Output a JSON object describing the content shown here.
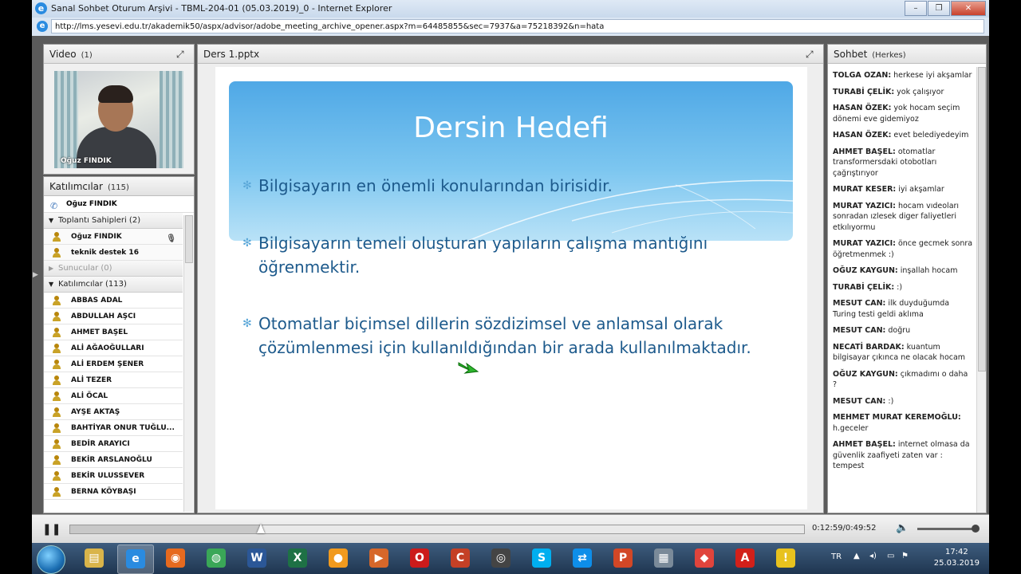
{
  "browser": {
    "title": "Sanal Sohbet Oturum Arşivi - TBML-204-01 (05.03.2019)_0 - Internet Explorer",
    "url": "http://lms.yesevi.edu.tr/akademik50/aspx/advisor/adobe_meeting_archive_opener.aspx?m=64485855&sec=7937&a=75218392&n=hata",
    "controls": [
      "–",
      "❐",
      "✕"
    ]
  },
  "video": {
    "title": "Video",
    "count": "(1)",
    "presenter": "Oğuz FINDIK"
  },
  "attendees": {
    "title": "Katılımcılar",
    "count": "(115)",
    "me": "Oğuz FINDIK",
    "hosts_group": "Toplantı Sahipleri (2)",
    "hosts": [
      "Oğuz FINDIK",
      "teknik destek 16"
    ],
    "presenters_group": "Sunucular (0)",
    "participants_group": "Katılımcılar (113)",
    "participants": [
      "ABBAS ADAL",
      "ABDULLAH AŞCI",
      "AHMET BAŞEL",
      "ALİ AĞAOĞULLARI",
      "ALİ ERDEM ŞENER",
      "ALİ TEZER",
      "ALİ ÖCAL",
      "AYŞE AKTAŞ",
      "BAHTİYAR ONUR TUĞLU...",
      "BEDİR ARAYICI",
      "BEKİR ARSLANOĞLU",
      "BEKİR ULUSSEVER",
      "BERNA KÖYBAŞI"
    ]
  },
  "share": {
    "title": "Ders 1.pptx",
    "slide_title": "Dersin Hedefi",
    "bullets": [
      "Bilgisayarın en önemli konularından birisidir.",
      "Bilgisayarın temeli oluşturan yapıların çalışma mantığını öğrenmektir.",
      "Otomatlar biçimsel dillerin sözdizimsel ve anlamsal olarak çözümlenmesi için kullanıldığından bir arada kullanılmaktadır."
    ],
    "bullet_symbol": "✻"
  },
  "chat": {
    "title": "Sohbet",
    "scope": "(Herkes)",
    "messages": [
      {
        "author": "TOLGA OZAN:",
        "text": " herkese iyi akşamlar"
      },
      {
        "author": "TURABİ ÇELİK:",
        "text": " yok çalışıyor"
      },
      {
        "author": "HASAN ÖZEK:",
        "text": " yok hocam seçim dönemi eve gidemiyoz"
      },
      {
        "author": "HASAN ÖZEK:",
        "text": " evet belediyedeyim"
      },
      {
        "author": "AHMET BAŞEL:",
        "text": " otomatlar transformersdaki otobotları çağrıştırıyor"
      },
      {
        "author": "MURAT KESER:",
        "text": " iyi akşamlar"
      },
      {
        "author": "MURAT YAZICI:",
        "text": " hocam vıdeoları sonradan ızlesek diger faliyetleri etkılıyormu"
      },
      {
        "author": "MURAT YAZICI:",
        "text": " önce gecmek sonra öğretmenmek :)"
      },
      {
        "author": "OĞUZ KAYGUN:",
        "text": " inşallah hocam"
      },
      {
        "author": "TURABİ ÇELİK:",
        "text": " :)"
      },
      {
        "author": "MESUT CAN:",
        "text": " ilk duyduğumda Turing testi geldi aklıma"
      },
      {
        "author": "MESUT CAN:",
        "text": " doğru"
      },
      {
        "author": "NECATİ BARDAK:",
        "text": " kuantum bilgisayar çıkınca ne olacak hocam"
      },
      {
        "author": "OĞUZ KAYGUN:",
        "text": " çıkmadımı o daha ?"
      },
      {
        "author": "MESUT CAN:",
        "text": " :)"
      },
      {
        "author": "MEHMET MURAT KEREMOĞLU:",
        "text": " h.geceler"
      },
      {
        "author": "AHMET BAŞEL:",
        "text": " internet olmasa da güvenlik zaafiyeti zaten var : tempest"
      }
    ]
  },
  "playback": {
    "time": "0:12:59/0:49:52",
    "progress": 0.26,
    "volume": 1.0
  },
  "taskbar": {
    "language": "TR",
    "time": "17:42",
    "date": "25.03.2019",
    "apps": [
      {
        "name": "explorer-app",
        "glyph": "▤",
        "color": "#d9b44a"
      },
      {
        "name": "internet-explorer-app",
        "glyph": "e",
        "color": "#2a8be0"
      },
      {
        "name": "firefox-app",
        "glyph": "◉",
        "color": "#e66a1f"
      },
      {
        "name": "chrome-app",
        "glyph": "◍",
        "color": "#3aa757"
      },
      {
        "name": "word-app",
        "glyph": "W",
        "color": "#2b5797"
      },
      {
        "name": "excel-app",
        "glyph": "X",
        "color": "#1e7145"
      },
      {
        "name": "paint-app",
        "glyph": "●",
        "color": "#f19a1e"
      },
      {
        "name": "media-app",
        "glyph": "▶",
        "color": "#d6672a"
      },
      {
        "name": "opera-app",
        "glyph": "O",
        "color": "#cc1b1b"
      },
      {
        "name": "ccleaner-app",
        "glyph": "C",
        "color": "#c44026"
      },
      {
        "name": "recorder-app",
        "glyph": "◎",
        "color": "#444444"
      },
      {
        "name": "skype-app",
        "glyph": "S",
        "color": "#00aff0"
      },
      {
        "name": "teamviewer-app",
        "glyph": "⇄",
        "color": "#0e8ee9"
      },
      {
        "name": "powerpoint-app",
        "glyph": "P",
        "color": "#d24726"
      },
      {
        "name": "calculator-app",
        "glyph": "▦",
        "color": "#7a8a99"
      },
      {
        "name": "anydesk-app",
        "glyph": "◆",
        "color": "#e0443c"
      },
      {
        "name": "acrobat-app",
        "glyph": "A",
        "color": "#d2201a"
      },
      {
        "name": "warning-app",
        "glyph": "!",
        "color": "#e8c21e"
      }
    ]
  }
}
